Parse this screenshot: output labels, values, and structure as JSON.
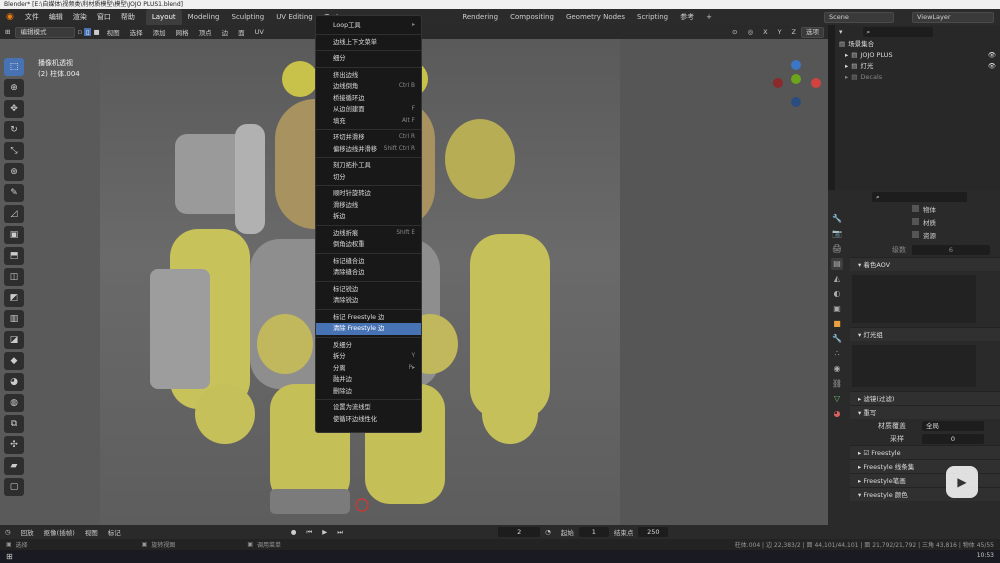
{
  "window": {
    "title": "Blender* [E:\\自媒体\\视频类\\利材质模型\\模型\\JOJO PLUS1.blend]"
  },
  "menubar": {
    "menus": [
      "文件",
      "编辑",
      "渲染",
      "窗口",
      "帮助"
    ],
    "workspaces": [
      "Layout",
      "Modeling",
      "Sculpting",
      "UV Editing",
      "Textu"
    ],
    "workspaces_right": [
      "Rendering",
      "Compositing",
      "Geometry Nodes",
      "Scripting",
      "参考"
    ],
    "scene": "Scene",
    "view_layer": "ViewLayer"
  },
  "header3d": {
    "mode": "编辑模式",
    "menus": [
      "视图",
      "选择",
      "添加",
      "网格",
      "顶点",
      "边",
      "面",
      "UV"
    ],
    "options": "选项",
    "axes": [
      "X",
      "Y",
      "Z"
    ]
  },
  "viewport": {
    "info_line1": "播像机透视",
    "info_line2": "(2) 柱体.004",
    "gizmo": {
      "x_color": "#d2423f",
      "y_color": "#6ba51b",
      "z_color": "#3b77c6"
    }
  },
  "context_menu": {
    "items": [
      {
        "label": "Loop工具",
        "shortcut": "▸",
        "sep_after": true
      },
      {
        "label": "边线上下文菜单",
        "shortcut": "",
        "sep_after": true
      },
      {
        "label": "细分",
        "shortcut": "",
        "sep_after": true
      },
      {
        "label": "挤出边线",
        "shortcut": ""
      },
      {
        "label": "边线倒角",
        "shortcut": "Ctrl B"
      },
      {
        "label": "桥接循环边",
        "shortcut": ""
      },
      {
        "label": "从边创建面",
        "shortcut": "F"
      },
      {
        "label": "填充",
        "shortcut": "Alt F",
        "sep_after": true
      },
      {
        "label": "环切并滑移",
        "shortcut": "Ctrl R"
      },
      {
        "label": "偏移边线并滑移",
        "shortcut": "Shift Ctrl R",
        "sep_after": true
      },
      {
        "label": "刻刀拓扑工具",
        "shortcut": ""
      },
      {
        "label": "切分",
        "shortcut": "",
        "sep_after": true
      },
      {
        "label": "顺时针旋转边",
        "shortcut": ""
      },
      {
        "label": "滑移边线",
        "shortcut": ""
      },
      {
        "label": "拆边",
        "shortcut": "",
        "sep_after": true
      },
      {
        "label": "边线折痕",
        "shortcut": "Shift E"
      },
      {
        "label": "倒角边权重",
        "shortcut": "",
        "sep_after": true
      },
      {
        "label": "标记缝合边",
        "shortcut": ""
      },
      {
        "label": "清除缝合边",
        "shortcut": "",
        "sep_after": true
      },
      {
        "label": "标记锐边",
        "shortcut": ""
      },
      {
        "label": "清除锐边",
        "shortcut": "",
        "sep_after": true
      },
      {
        "label": "标记 Freestyle 边",
        "shortcut": ""
      },
      {
        "label": "清除 Freestyle 边",
        "shortcut": "",
        "highlighted": true,
        "sep_after": true
      },
      {
        "label": "反细分",
        "shortcut": ""
      },
      {
        "label": "拆分",
        "shortcut": "Y"
      },
      {
        "label": "分离",
        "shortcut": "P▸"
      },
      {
        "label": "融并边",
        "shortcut": ""
      },
      {
        "label": "删除边",
        "shortcut": "",
        "sep_after": true
      },
      {
        "label": "设置为流线型",
        "shortcut": ""
      },
      {
        "label": "使循环边线性化",
        "shortcut": ""
      }
    ]
  },
  "outliner": {
    "rows": [
      {
        "label": "场景集合",
        "indent": 0
      },
      {
        "label": "JOJO PLUS",
        "indent": 1
      },
      {
        "label": "灯光",
        "indent": 1
      },
      {
        "label": "Decals",
        "indent": 1
      }
    ]
  },
  "properties": {
    "checkboxes": [
      "物体",
      "材质",
      "资源"
    ],
    "level_label": "级数",
    "level_value": "6",
    "panels": [
      {
        "label": "着色AOV"
      },
      {
        "label": "灯光组"
      },
      {
        "label": "滤镜(过滤)"
      },
      {
        "label": "重写"
      }
    ],
    "material_override_label": "材质覆盖",
    "material_override_value": "全局",
    "samples_label": "采样",
    "samples_value": "0",
    "freestyle_panels": [
      "Freestyle",
      "Freestyle 线条集",
      "Freestyle笔画",
      "Freestyle 颜色"
    ]
  },
  "timeline": {
    "menus": [
      "回放",
      "抠像(插帧)",
      "视图",
      "标记"
    ],
    "current_frame": "2",
    "start_label": "起始",
    "start_value": "1",
    "end_label": "结束点",
    "end_value": "250"
  },
  "statusbar": {
    "left": "选择",
    "mid1": "旋转视图",
    "mid2": "调用菜单",
    "right": "柱体.004 | 边 22,383/2 | 面 44,101/44,101 | 面 21,792/21,792 | 三角 43,816 | 物体 45/55"
  },
  "taskbar": {
    "time": "10:53"
  }
}
